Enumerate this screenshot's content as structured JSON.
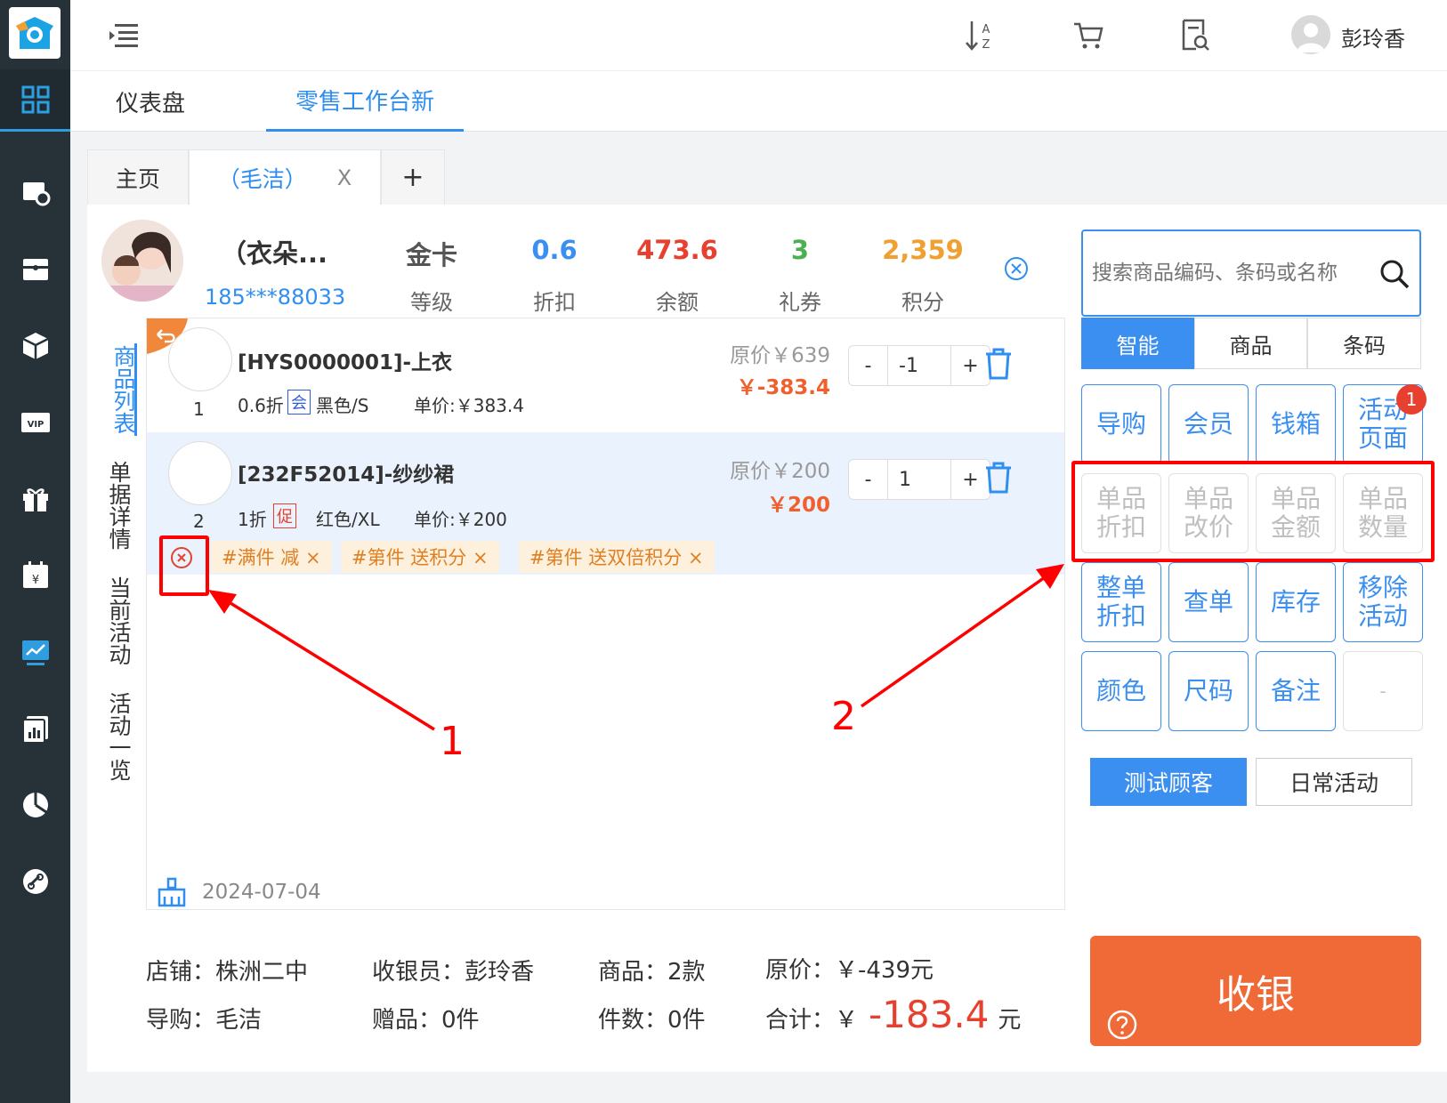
{
  "app": {
    "logo": "app-logo",
    "nav_icons": [
      "dashboard-icon",
      "pos-settings-icon",
      "register-icon",
      "box-icon",
      "vip-icon",
      "gift-icon",
      "calendar-icon",
      "trend-chart-icon",
      "report-icon",
      "pie-chart-icon",
      "link-icon"
    ]
  },
  "header": {
    "user_name": "彭玲香"
  },
  "tabs": [
    {
      "label": "仪表盘"
    },
    {
      "label": "零售工作台新"
    }
  ],
  "subtabs": {
    "home": "主页",
    "guide": "（毛洁）",
    "close": "X",
    "add": "+"
  },
  "member": {
    "name": "（衣朵...",
    "phone": "185***88033",
    "stats": [
      {
        "value": "金卡",
        "label": "等级",
        "color": "#555555"
      },
      {
        "value": "0.6",
        "label": "折扣",
        "color": "#3b8ff0"
      },
      {
        "value": "473.6",
        "label": "余额",
        "color": "#e8402f"
      },
      {
        "value": "3",
        "label": "礼券",
        "color": "#4caf50"
      },
      {
        "value": "2,359",
        "label": "积分",
        "color": "#f0a030"
      }
    ]
  },
  "vtabs": [
    "商品列表",
    "单据详情",
    "当前活动",
    "活动一览"
  ],
  "items": [
    {
      "index": "1",
      "name": "[HYS0000001]-上衣",
      "discount": "0.6折",
      "badge": "会",
      "spec": "黑色/S",
      "unit_price": "单价:￥383.4",
      "orig": "原价￥639",
      "price": "￥-383.4",
      "qty": "-1"
    },
    {
      "index": "2",
      "name": "[232F52014]-纱纱裙",
      "discount": "1折",
      "badge": "促",
      "spec": "红色/XL",
      "unit_price": "单价:￥200",
      "orig": "原价￥200",
      "price": "￥200",
      "qty": "1"
    }
  ],
  "promo_tags": [
    "#满件 减 ×",
    "#第件 送积分 ×",
    "#第件 送双倍积分 ×"
  ],
  "list_footer": {
    "date": "2024-07-04"
  },
  "search": {
    "placeholder": "搜索商品编码、条码或名称"
  },
  "modes": [
    "智能",
    "商品",
    "条码"
  ],
  "functions": [
    {
      "label": "导购",
      "enabled": true
    },
    {
      "label": "会员",
      "enabled": true
    },
    {
      "label": "钱箱",
      "enabled": true
    },
    {
      "label": "活动页面",
      "enabled": true,
      "badge": "1"
    },
    {
      "label": "单品折扣",
      "enabled": false
    },
    {
      "label": "单品改价",
      "enabled": false
    },
    {
      "label": "单品金额",
      "enabled": false
    },
    {
      "label": "单品数量",
      "enabled": false
    },
    {
      "label": "整单折扣",
      "enabled": true
    },
    {
      "label": "查单",
      "enabled": true
    },
    {
      "label": "库存",
      "enabled": true
    },
    {
      "label": "移除活动",
      "enabled": true
    },
    {
      "label": "颜色",
      "enabled": true
    },
    {
      "label": "尺码",
      "enabled": true
    },
    {
      "label": "备注",
      "enabled": true
    },
    {
      "label": "-",
      "enabled": false
    }
  ],
  "customer_buttons": [
    "测试顾客",
    "日常活动"
  ],
  "footer": {
    "store": "店铺：株洲二中",
    "cashier": "收银员：彭玲香",
    "goods": "商品：2款",
    "orig_price": "原价：￥-439元",
    "guide": "导购：毛洁",
    "gifts": "赠品：0件",
    "pieces": "件数：0件",
    "total_label": "合计：￥",
    "total_value": "-183.4",
    "total_unit": "元"
  },
  "checkout_label": "收银",
  "annotations": [
    "1",
    "2"
  ]
}
